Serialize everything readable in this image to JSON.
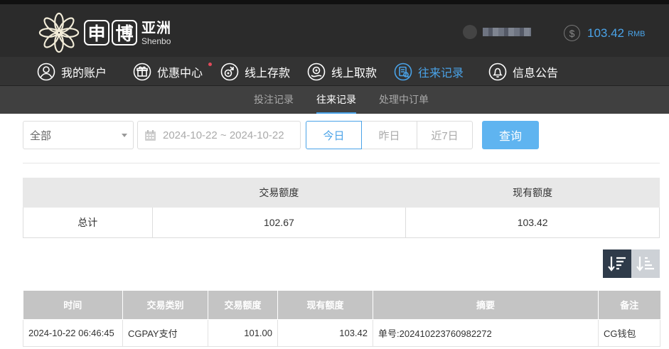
{
  "header": {
    "logo": {
      "box1": "申",
      "box2": "博",
      "cn": "亚洲",
      "en": "Shenbo"
    },
    "balance": {
      "symbol": "$",
      "amount": "103.42",
      "unit": "RMB"
    }
  },
  "nav": {
    "items": [
      {
        "label": "我的账户",
        "icon": "user-icon"
      },
      {
        "label": "优惠中心",
        "icon": "gift-icon"
      },
      {
        "label": "线上存款",
        "icon": "deposit-icon"
      },
      {
        "label": "线上取款",
        "icon": "withdraw-icon"
      },
      {
        "label": "往来记录",
        "icon": "records-icon"
      },
      {
        "label": "信息公告",
        "icon": "bell-icon"
      }
    ],
    "active": "往来记录"
  },
  "subnav": {
    "items": [
      {
        "label": "投注记录"
      },
      {
        "label": "往来记录"
      },
      {
        "label": "处理中订单"
      }
    ],
    "active": "往来记录"
  },
  "filters": {
    "type_value": "全部",
    "date_range": "2024-10-22 ~ 2024-10-22",
    "range_buttons": [
      {
        "label": "今日"
      },
      {
        "label": "昨日"
      },
      {
        "label": "近7日"
      }
    ],
    "active_range": "今日",
    "query_label": "查询"
  },
  "summary": {
    "headers": [
      "",
      "交易额度",
      "现有额度"
    ],
    "row": {
      "label": "总计",
      "transaction": "102.67",
      "current": "103.42"
    }
  },
  "sort": {
    "desc_icon": "sort-desc-icon",
    "asc_icon": "sort-asc-icon"
  },
  "records": {
    "headers": [
      "时间",
      "交易类别",
      "交易额度",
      "现有额度",
      "摘要",
      "备注"
    ],
    "rows": [
      {
        "time": "2024-10-22 06:46:45",
        "type": "CGPAY支付",
        "amount": "101.00",
        "balance": "103.42",
        "summary": "单号:202410223760982272",
        "note": "CG钱包"
      }
    ]
  },
  "colors": {
    "accent": "#4aa3e8",
    "header_bg": "#2b2b2b",
    "nav_bg": "#333333",
    "subnav_bg": "#404040",
    "query_btn": "#5fb4f0"
  }
}
